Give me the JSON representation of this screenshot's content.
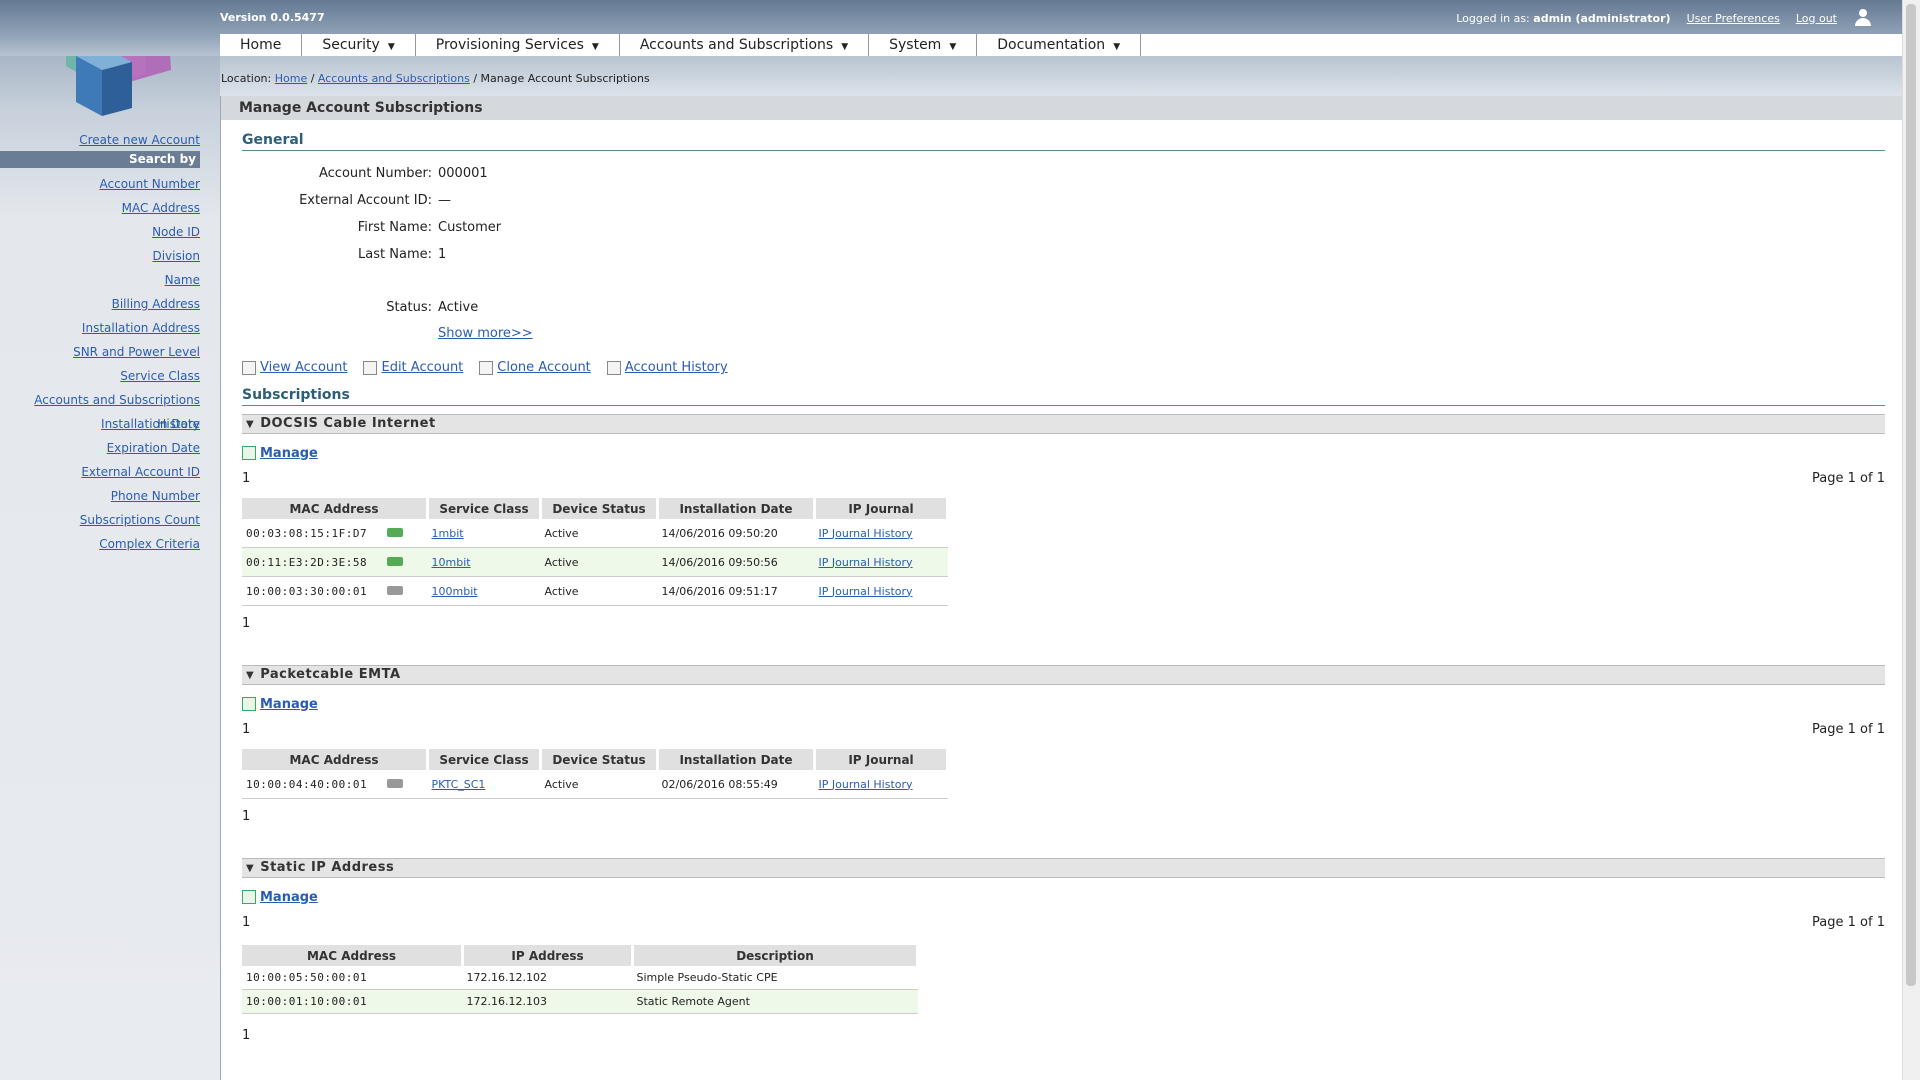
{
  "header": {
    "version": "Version 0.0.5477",
    "logged_in_prefix": "Logged in as:",
    "logged_in_user": "admin (administrator)",
    "user_preferences": "User Preferences",
    "logout": "Log out"
  },
  "nav": {
    "items": [
      {
        "label": "Home",
        "dropdown": false
      },
      {
        "label": "Security",
        "dropdown": true
      },
      {
        "label": "Provisioning Services",
        "dropdown": true
      },
      {
        "label": "Accounts and Subscriptions",
        "dropdown": true
      },
      {
        "label": "System",
        "dropdown": true
      },
      {
        "label": "Documentation",
        "dropdown": true
      }
    ]
  },
  "location": {
    "prefix": "Location:",
    "crumbs": [
      "Home",
      "Accounts and Subscriptions"
    ],
    "current": "Manage Account Subscriptions"
  },
  "sidebar": {
    "create": "Create new Account",
    "search_by": "Search by",
    "links": [
      "Account Number",
      "MAC Address",
      "Node ID",
      "Division",
      "Name",
      "Billing Address",
      "Installation Address",
      "SNR and Power Level",
      "Service Class",
      "Accounts and Subscriptions History",
      "Installation Date",
      "Expiration Date",
      "External Account ID",
      "Phone Number",
      "Subscriptions Count",
      "Complex Criteria"
    ]
  },
  "page": {
    "title": "Manage Account Subscriptions",
    "general_title": "General",
    "fields": {
      "account_number": {
        "label": "Account Number:",
        "value": "000001"
      },
      "external_id": {
        "label": "External Account ID:",
        "value": "—"
      },
      "first_name": {
        "label": "First Name:",
        "value": "Customer"
      },
      "last_name": {
        "label": "Last Name:",
        "value": "1"
      },
      "status": {
        "label": "Status:",
        "value": "Active"
      }
    },
    "show_more": "Show more>>",
    "actions": [
      "View Account",
      "Edit Account",
      "Clone Account",
      "Account History"
    ],
    "subscriptions_title": "Subscriptions"
  },
  "docsis": {
    "title": "DOCSIS Cable Internet",
    "manage": "Manage",
    "page_num": "1",
    "pager": "Page 1 of 1",
    "footer_num": "1",
    "headers": [
      "MAC Address",
      "Service Class",
      "Device Status",
      "Installation Date",
      "IP Journal"
    ],
    "rows": [
      {
        "mac": "00:03:08:15:1F:D7",
        "service": "1mbit",
        "status": "Active",
        "date": "14/06/2016 09:50:20",
        "journal": "IP Journal History",
        "icon": "green"
      },
      {
        "mac": "00:11:E3:2D:3E:58",
        "service": "10mbit",
        "status": "Active",
        "date": "14/06/2016 09:50:56",
        "journal": "IP Journal History",
        "icon": "green"
      },
      {
        "mac": "10:00:03:30:00:01",
        "service": "100mbit",
        "status": "Active",
        "date": "14/06/2016 09:51:17",
        "journal": "IP Journal History",
        "icon": "gray"
      }
    ]
  },
  "emta": {
    "title": "Packetcable EMTA",
    "manage": "Manage",
    "page_num": "1",
    "pager": "Page 1 of 1",
    "footer_num": "1",
    "headers": [
      "MAC Address",
      "Service Class",
      "Device Status",
      "Installation Date",
      "IP Journal"
    ],
    "rows": [
      {
        "mac": "10:00:04:40:00:01",
        "service": "PKTC_SC1",
        "status": "Active",
        "date": "02/06/2016 08:55:49",
        "journal": "IP Journal History"
      }
    ]
  },
  "static": {
    "title": "Static IP Address",
    "manage": "Manage",
    "page_num": "1",
    "pager": "Page 1 of 1",
    "footer_num": "1",
    "headers": [
      "MAC Address",
      "IP Address",
      "Description"
    ],
    "rows": [
      {
        "mac": "10:00:05:50:00:01",
        "ip": "172.16.12.102",
        "desc": "Simple Pseudo-Static CPE"
      },
      {
        "mac": "10:00:01:10:00:01",
        "ip": "172.16.12.103",
        "desc": "Static Remote Agent"
      }
    ]
  }
}
